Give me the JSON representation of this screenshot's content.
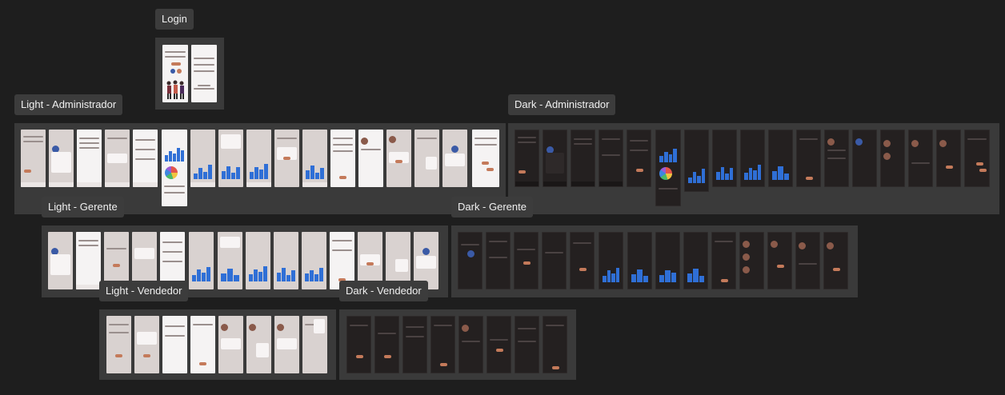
{
  "app": {
    "canvas_background": "#1e1e1e"
  },
  "sections": [
    {
      "id": "login",
      "label": "Login"
    },
    {
      "id": "light-admin",
      "label": "Light - Administrador"
    },
    {
      "id": "dark-admin",
      "label": "Dark - Administrador"
    },
    {
      "id": "light-gerente",
      "label": "Light - Gerente"
    },
    {
      "id": "dark-gerente",
      "label": "Dark - Gerente"
    },
    {
      "id": "light-vendedor",
      "label": "Light - Vendedor"
    },
    {
      "id": "dark-vendedor",
      "label": "Dark - Vendedor"
    }
  ],
  "colors": {
    "label_background": "#3c3c3c",
    "frame_background": "#3a3a3a",
    "accent_button": "#c47a5a",
    "chart_bar": "#2f6fd6",
    "light_screen": "#d9d2d0",
    "dark_screen": "#242020"
  }
}
